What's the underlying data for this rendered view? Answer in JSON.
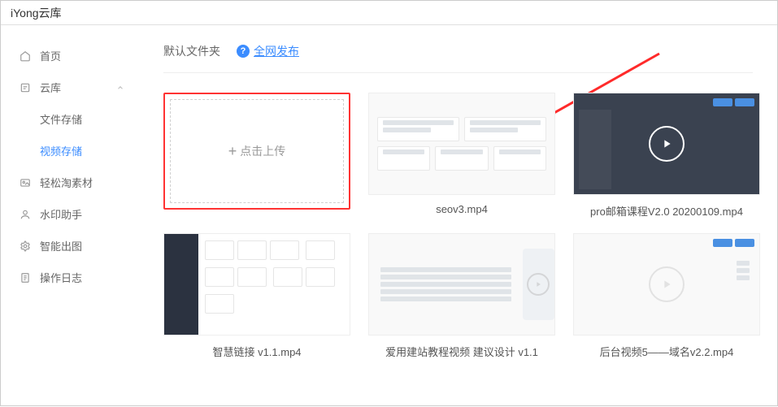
{
  "app_title": "iYong云库",
  "sidebar": {
    "items": [
      {
        "label": "首页",
        "icon": "home"
      },
      {
        "label": "云库",
        "icon": "cloud",
        "expanded": true
      },
      {
        "label": "文件存储"
      },
      {
        "label": "视频存储"
      },
      {
        "label": "轻松淘素材",
        "icon": "image"
      },
      {
        "label": "水印助手",
        "icon": "user"
      },
      {
        "label": "智能出图",
        "icon": "gear"
      },
      {
        "label": "操作日志",
        "icon": "page"
      }
    ]
  },
  "toolbar": {
    "folder_label": "默认文件夹",
    "publish_link": "全网发布"
  },
  "upload": {
    "label": "点击上传"
  },
  "videos": [
    {
      "title": "seov3.mp4"
    },
    {
      "title": "pro邮箱课程V2.0 20200109.mp4"
    },
    {
      "title": "智慧链接 v1.1.mp4"
    },
    {
      "title": "爱用建站教程视频 建议设计 v1.1"
    },
    {
      "title": "后台视频5——域名v2.2.mp4"
    }
  ]
}
